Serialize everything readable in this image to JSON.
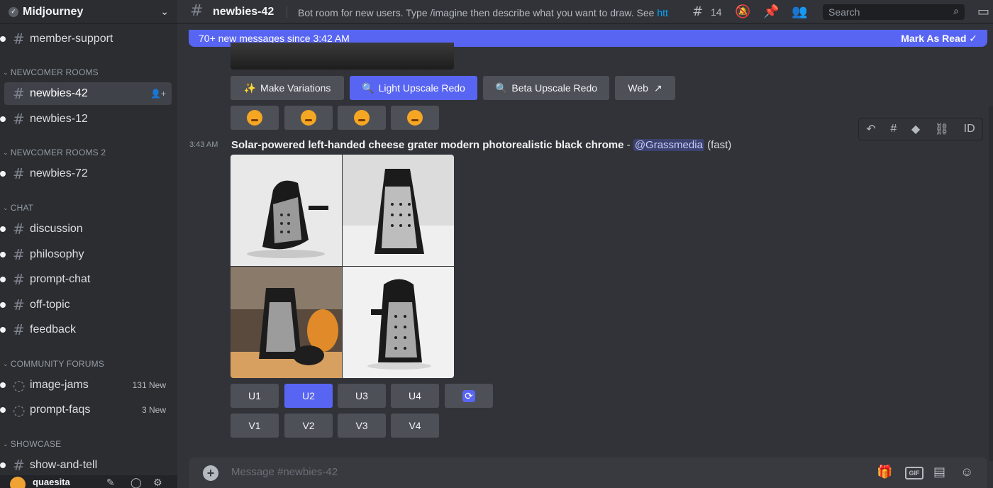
{
  "server": {
    "name": "Midjourney"
  },
  "sidebar": {
    "channels_top": [
      {
        "label": "member-support"
      }
    ],
    "categories": [
      {
        "label": "NEWCOMER ROOMS"
      },
      {
        "label": "NEWCOMER ROOMS 2"
      },
      {
        "label": "CHAT"
      },
      {
        "label": "COMMUNITY FORUMS"
      },
      {
        "label": "SHOWCASE"
      }
    ],
    "channels": [
      {
        "label": "newbies-42"
      },
      {
        "label": "newbies-12"
      },
      {
        "label": "newbies-72"
      },
      {
        "label": "discussion"
      },
      {
        "label": "philosophy"
      },
      {
        "label": "prompt-chat"
      },
      {
        "label": "off-topic"
      },
      {
        "label": "feedback"
      },
      {
        "label": "image-jams",
        "badge": "131 New"
      },
      {
        "label": "prompt-faqs",
        "badge": "3 New"
      },
      {
        "label": "show-and-tell"
      }
    ],
    "user": {
      "name": "quaesita"
    }
  },
  "topbar": {
    "channel_name": "newbies-42",
    "topic": "Bot room for new users. Type /imagine then describe what you want to draw. See ",
    "topic_link": "htt",
    "threads_count": "14",
    "search_placeholder": "Search"
  },
  "banner": {
    "text": "70+ new messages since 3:42 AM",
    "action": "Mark As Read"
  },
  "actions": {
    "make_variations": "Make Variations",
    "light_upscale_redo": "Light Upscale Redo",
    "beta_upscale_redo": "Beta Upscale Redo",
    "web": "Web"
  },
  "message": {
    "timestamp": "3:43 AM",
    "prompt": "Solar-powered left-handed cheese grater modern photorealistic black chrome",
    "separator": " - ",
    "mention": "@Grassmedia",
    "mode": " (fast)"
  },
  "upscale_buttons": [
    "U1",
    "U2",
    "U3",
    "U4"
  ],
  "variation_buttons": [
    "V1",
    "V2",
    "V3",
    "V4"
  ],
  "composer": {
    "placeholder": "Message #newbies-42"
  },
  "colors": {
    "accent": "#5865f2",
    "bg": "#313338",
    "sidebar": "#2b2d31"
  }
}
